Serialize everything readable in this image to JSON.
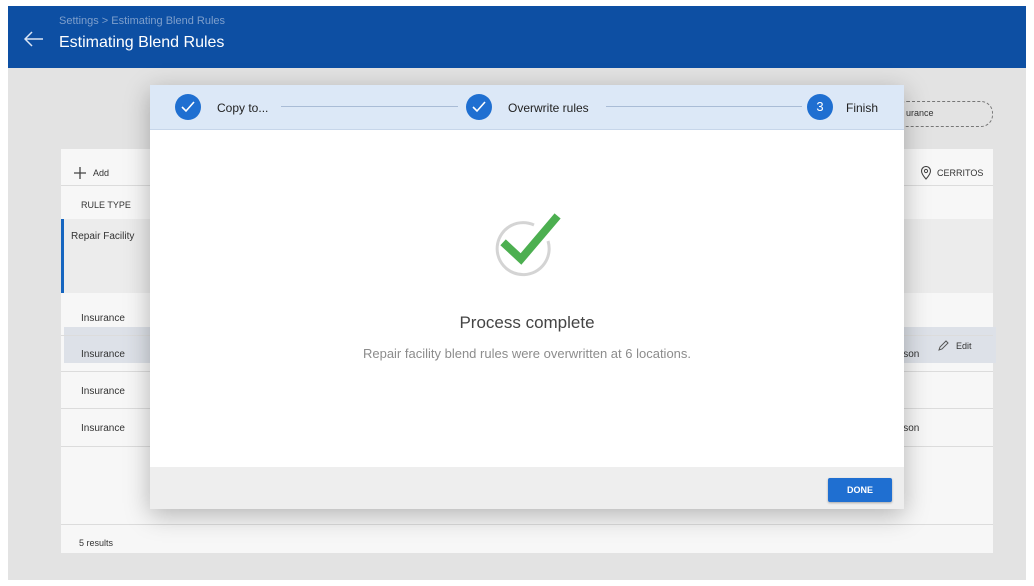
{
  "header": {
    "breadcrumb": "Settings > Estimating Blend Rules",
    "title": "Estimating Blend Rules"
  },
  "background": {
    "filter_text": "urance",
    "add_label": "Add",
    "column_rule_type": "RULE TYPE",
    "location_label": "CERRITOS",
    "edit_label": "Edit",
    "rows": [
      {
        "rule_type": "Repair Facility",
        "right": ""
      },
      {
        "rule_type": "Insurance",
        "right": ""
      },
      {
        "rule_type": "Insurance",
        "right": "lson"
      },
      {
        "rule_type": "Insurance",
        "right": ""
      },
      {
        "rule_type": "Insurance",
        "right": "lson"
      }
    ],
    "results": "5 results"
  },
  "modal": {
    "steps": [
      {
        "label": "Copy to...",
        "state": "complete"
      },
      {
        "label": "Overwrite rules",
        "state": "complete"
      },
      {
        "label": "Finish",
        "number": "3",
        "state": "active"
      }
    ],
    "success_title": "Process complete",
    "success_message": "Repair facility blend rules were overwritten at 6 locations.",
    "done_label": "DONE"
  },
  "colors": {
    "brand_blue": "#0d4fa3",
    "accent_blue": "#1f6fd1",
    "success_green": "#4caf50"
  }
}
